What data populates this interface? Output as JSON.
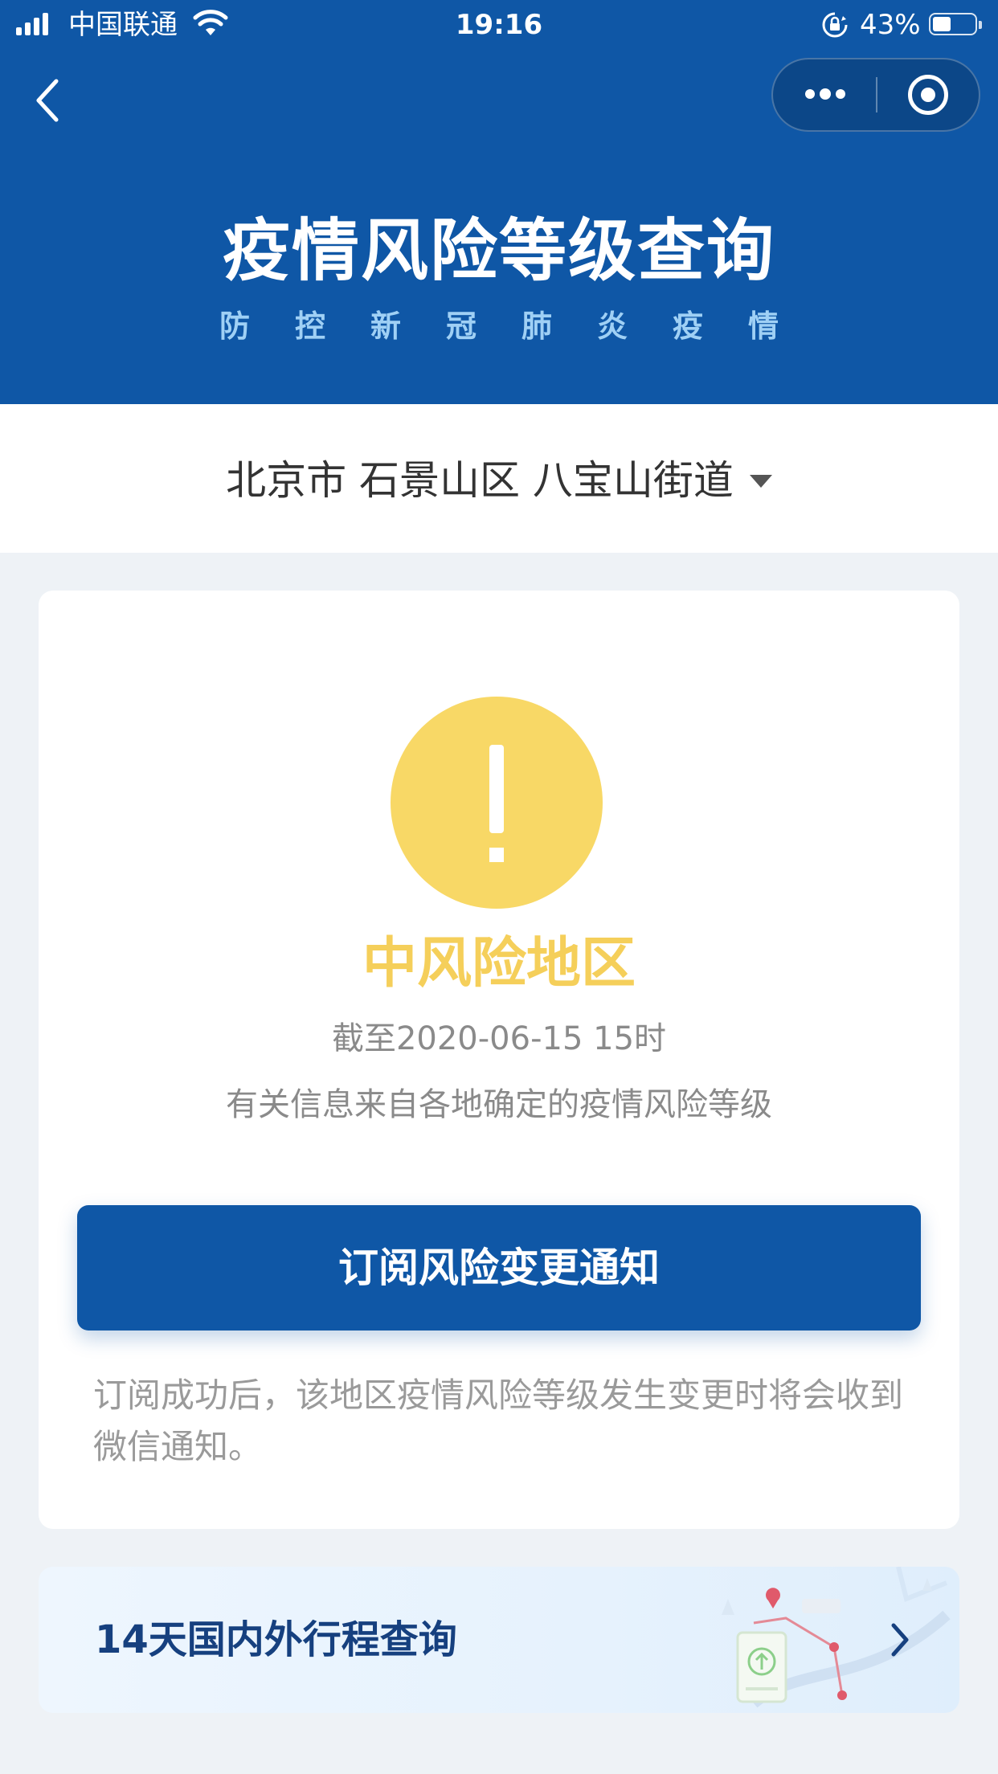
{
  "status_bar": {
    "carrier": "中国联通",
    "time": "19:16",
    "battery_percent": "43%",
    "battery_level": 0.43
  },
  "nav": {
    "back_icon": "chevron-left-icon",
    "more_icon": "more-dots-icon",
    "close_icon": "target-circle-icon"
  },
  "banner": {
    "title": "疫情风险等级查询",
    "subtitle": "防控新冠肺炎疫情"
  },
  "location": {
    "text": "北京市 石景山区 八宝山街道",
    "dropdown_icon": "caret-down-icon"
  },
  "risk_card": {
    "icon": "exclamation-circle-icon",
    "level": "中风险地区",
    "as_of": "截至2020-06-15 15时",
    "source": "有关信息来自各地确定的疫情风险等级",
    "subscribe_label": "订阅风险变更通知",
    "note": "订阅成功后，该地区疫情风险等级发生变更时将会收到微信通知。"
  },
  "trip_query": {
    "label": "14天国内外行程查询",
    "arrow_icon": "chevron-right-icon"
  },
  "colors": {
    "brand_blue": "#0f57a6",
    "risk_yellow": "#f8d866",
    "risk_text_yellow": "#f5cf5a",
    "page_bg": "#eef2f6"
  }
}
